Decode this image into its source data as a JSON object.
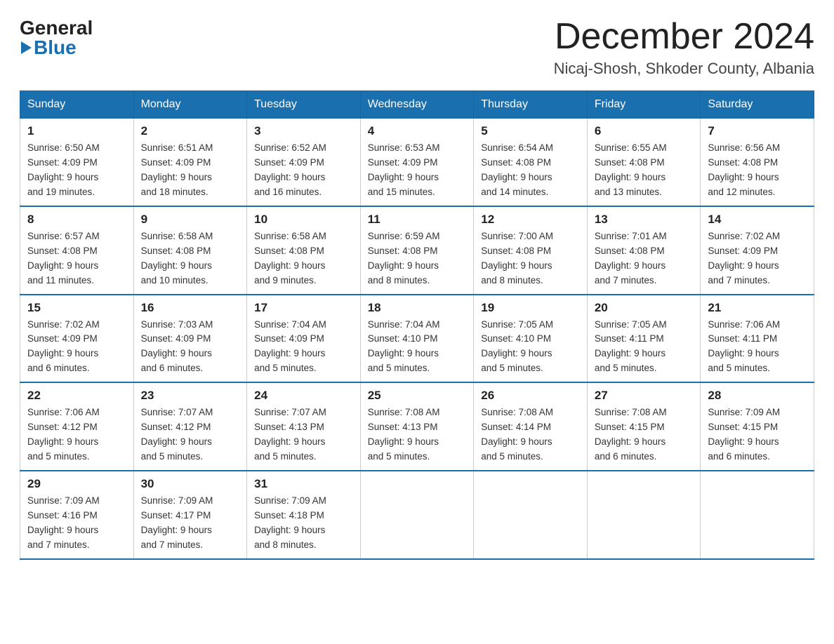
{
  "header": {
    "logo_general": "General",
    "logo_blue": "Blue",
    "title": "December 2024",
    "subtitle": "Nicaj-Shosh, Shkoder County, Albania"
  },
  "calendar": {
    "days": [
      "Sunday",
      "Monday",
      "Tuesday",
      "Wednesday",
      "Thursday",
      "Friday",
      "Saturday"
    ],
    "weeks": [
      [
        {
          "num": "1",
          "info": "Sunrise: 6:50 AM\nSunset: 4:09 PM\nDaylight: 9 hours\nand 19 minutes."
        },
        {
          "num": "2",
          "info": "Sunrise: 6:51 AM\nSunset: 4:09 PM\nDaylight: 9 hours\nand 18 minutes."
        },
        {
          "num": "3",
          "info": "Sunrise: 6:52 AM\nSunset: 4:09 PM\nDaylight: 9 hours\nand 16 minutes."
        },
        {
          "num": "4",
          "info": "Sunrise: 6:53 AM\nSunset: 4:09 PM\nDaylight: 9 hours\nand 15 minutes."
        },
        {
          "num": "5",
          "info": "Sunrise: 6:54 AM\nSunset: 4:08 PM\nDaylight: 9 hours\nand 14 minutes."
        },
        {
          "num": "6",
          "info": "Sunrise: 6:55 AM\nSunset: 4:08 PM\nDaylight: 9 hours\nand 13 minutes."
        },
        {
          "num": "7",
          "info": "Sunrise: 6:56 AM\nSunset: 4:08 PM\nDaylight: 9 hours\nand 12 minutes."
        }
      ],
      [
        {
          "num": "8",
          "info": "Sunrise: 6:57 AM\nSunset: 4:08 PM\nDaylight: 9 hours\nand 11 minutes."
        },
        {
          "num": "9",
          "info": "Sunrise: 6:58 AM\nSunset: 4:08 PM\nDaylight: 9 hours\nand 10 minutes."
        },
        {
          "num": "10",
          "info": "Sunrise: 6:58 AM\nSunset: 4:08 PM\nDaylight: 9 hours\nand 9 minutes."
        },
        {
          "num": "11",
          "info": "Sunrise: 6:59 AM\nSunset: 4:08 PM\nDaylight: 9 hours\nand 8 minutes."
        },
        {
          "num": "12",
          "info": "Sunrise: 7:00 AM\nSunset: 4:08 PM\nDaylight: 9 hours\nand 8 minutes."
        },
        {
          "num": "13",
          "info": "Sunrise: 7:01 AM\nSunset: 4:08 PM\nDaylight: 9 hours\nand 7 minutes."
        },
        {
          "num": "14",
          "info": "Sunrise: 7:02 AM\nSunset: 4:09 PM\nDaylight: 9 hours\nand 7 minutes."
        }
      ],
      [
        {
          "num": "15",
          "info": "Sunrise: 7:02 AM\nSunset: 4:09 PM\nDaylight: 9 hours\nand 6 minutes."
        },
        {
          "num": "16",
          "info": "Sunrise: 7:03 AM\nSunset: 4:09 PM\nDaylight: 9 hours\nand 6 minutes."
        },
        {
          "num": "17",
          "info": "Sunrise: 7:04 AM\nSunset: 4:09 PM\nDaylight: 9 hours\nand 5 minutes."
        },
        {
          "num": "18",
          "info": "Sunrise: 7:04 AM\nSunset: 4:10 PM\nDaylight: 9 hours\nand 5 minutes."
        },
        {
          "num": "19",
          "info": "Sunrise: 7:05 AM\nSunset: 4:10 PM\nDaylight: 9 hours\nand 5 minutes."
        },
        {
          "num": "20",
          "info": "Sunrise: 7:05 AM\nSunset: 4:11 PM\nDaylight: 9 hours\nand 5 minutes."
        },
        {
          "num": "21",
          "info": "Sunrise: 7:06 AM\nSunset: 4:11 PM\nDaylight: 9 hours\nand 5 minutes."
        }
      ],
      [
        {
          "num": "22",
          "info": "Sunrise: 7:06 AM\nSunset: 4:12 PM\nDaylight: 9 hours\nand 5 minutes."
        },
        {
          "num": "23",
          "info": "Sunrise: 7:07 AM\nSunset: 4:12 PM\nDaylight: 9 hours\nand 5 minutes."
        },
        {
          "num": "24",
          "info": "Sunrise: 7:07 AM\nSunset: 4:13 PM\nDaylight: 9 hours\nand 5 minutes."
        },
        {
          "num": "25",
          "info": "Sunrise: 7:08 AM\nSunset: 4:13 PM\nDaylight: 9 hours\nand 5 minutes."
        },
        {
          "num": "26",
          "info": "Sunrise: 7:08 AM\nSunset: 4:14 PM\nDaylight: 9 hours\nand 5 minutes."
        },
        {
          "num": "27",
          "info": "Sunrise: 7:08 AM\nSunset: 4:15 PM\nDaylight: 9 hours\nand 6 minutes."
        },
        {
          "num": "28",
          "info": "Sunrise: 7:09 AM\nSunset: 4:15 PM\nDaylight: 9 hours\nand 6 minutes."
        }
      ],
      [
        {
          "num": "29",
          "info": "Sunrise: 7:09 AM\nSunset: 4:16 PM\nDaylight: 9 hours\nand 7 minutes."
        },
        {
          "num": "30",
          "info": "Sunrise: 7:09 AM\nSunset: 4:17 PM\nDaylight: 9 hours\nand 7 minutes."
        },
        {
          "num": "31",
          "info": "Sunrise: 7:09 AM\nSunset: 4:18 PM\nDaylight: 9 hours\nand 8 minutes."
        },
        null,
        null,
        null,
        null
      ]
    ]
  }
}
